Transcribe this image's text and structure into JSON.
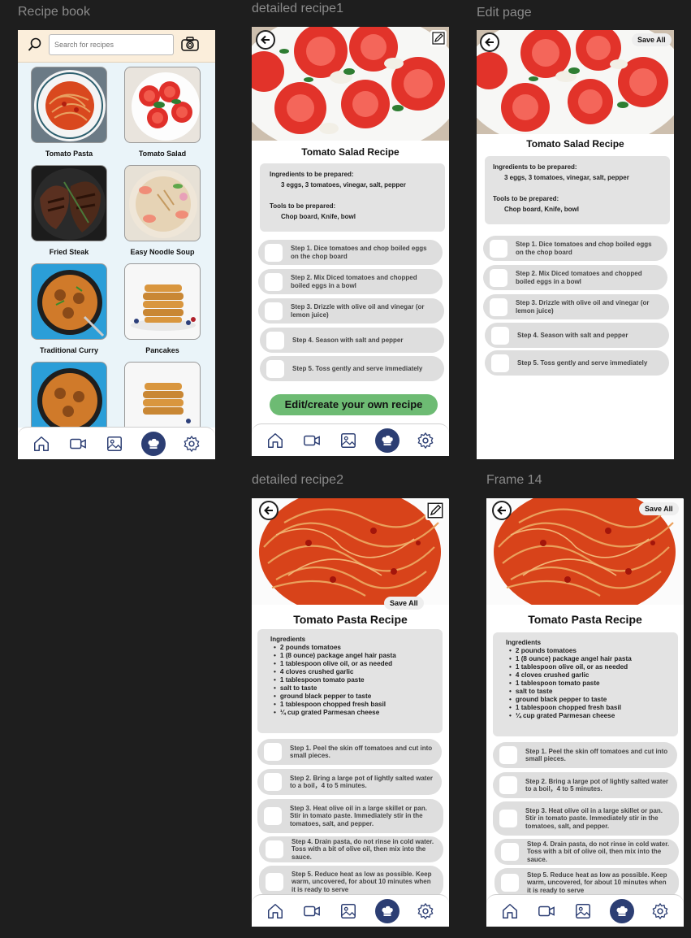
{
  "frame_labels": {
    "recipe_book": "Recipe book",
    "detailed_recipe1": "detailed recipe1",
    "edit_page": "Edit page",
    "detailed_recipe2": "detailed recipe2",
    "frame14": "Frame 14"
  },
  "recipe_book": {
    "search_placeholder": "Search for recipes",
    "recipes": [
      {
        "name": "Tomato Pasta"
      },
      {
        "name": "Tomato Salad"
      },
      {
        "name": "Fried Steak"
      },
      {
        "name": "Easy Noodle Soup"
      },
      {
        "name": "Traditional Curry"
      },
      {
        "name": "Pancakes"
      }
    ]
  },
  "salad": {
    "title": "Tomato Salad Recipe",
    "ingredients_heading": "Ingredients to be prepared:",
    "ingredients_text": "3 eggs, 3 tomatoes,  vinegar, salt, pepper",
    "tools_heading": "Tools to be prepared:",
    "tools_text": "Chop board, Knife, bowl",
    "steps": [
      "Step 1.  Dice tomatoes and chop boiled eggs on the chop board",
      "Step 2.  Mix Diced tomatoes and chopped boiled eggs in a bowl",
      "Step 3.  Drizzle with olive oil and vinegar (or lemon juice)",
      "Step 4.  Season with salt and pepper",
      "Step 5.  Toss gently and serve immediately"
    ],
    "cta": "Edit/create your own recipe",
    "save_all": "Save All"
  },
  "pasta": {
    "title": "Tomato Pasta Recipe",
    "ingredients_heading": "Ingredients",
    "ingredients": [
      "2 pounds tomatoes",
      "1 (8 ounce) package angel hair pasta",
      "1 tablespoon olive oil, or as needed",
      "4 cloves crushed garlic",
      "1 tablespoon tomato paste",
      "salt to taste",
      "ground black pepper to taste",
      "1 tablespoon chopped fresh basil",
      "¼ cup grated Parmesan cheese"
    ],
    "steps": [
      "Step 1. Peel the skin off tomatoes and cut into small pieces.",
      "Step 2.  Bring a large pot of lightly salted water to a boil，4 to 5 minutes.",
      "Step 3. Heat olive oil in a large skillet or pan.  Stir in tomato paste. Immediately stir in the tomatoes, salt, and pepper.",
      "Step 4. Drain pasta, do not rinse in cold water. Toss with a bit of olive oil, then mix into the sauce.",
      "Step 5.  Reduce heat as low as possible. Keep warm, uncovered, for about 10 minutes when it is ready to serve"
    ],
    "save_all": "Save All"
  },
  "icons": [
    "home-icon",
    "video-icon",
    "gallery-icon",
    "chef-hat-icon",
    "settings-icon",
    "search-icon",
    "camera-icon",
    "back-arrow-icon",
    "edit-pencil-icon"
  ],
  "colors": {
    "nav_active": "#2c3e73",
    "cta": "#6dbb73",
    "search_bar": "#fbeedb",
    "grid_bg": "#eaf4f9"
  }
}
